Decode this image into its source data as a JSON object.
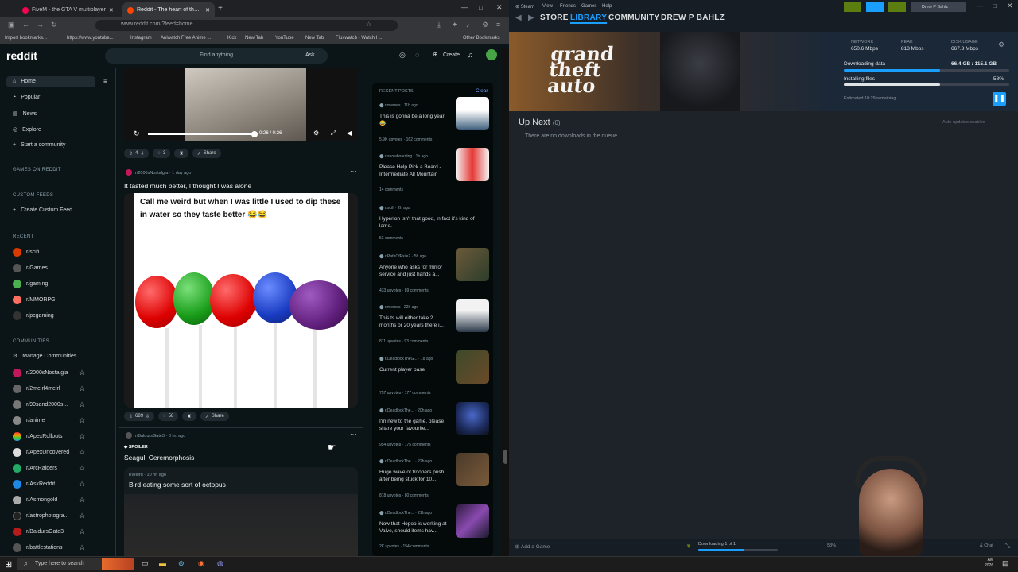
{
  "browser": {
    "tabs": [
      {
        "label": "FiveM - the GTA V multiplayer"
      },
      {
        "label": "Reddit - The heart of the intern"
      }
    ],
    "url": "www.reddit.com/?feed=home",
    "bookmarks": [
      "Import bookmarks...",
      "https://www.youtube...",
      "Instagram",
      "Aniwatch Free Anime ...",
      "Kick",
      "New Tab",
      "YouTube",
      "New Tab",
      "Fluxwatch - Watch H...",
      "Other Bookmarks"
    ]
  },
  "reddit": {
    "logo": "reddit",
    "search_placeholder": "Find anything",
    "ask": "Ask",
    "create": "Create",
    "nav": [
      "Home",
      "Popular",
      "News",
      "Explore",
      "Start a community"
    ],
    "games_header": "GAMES ON REDDIT",
    "custom_header": "CUSTOM FEEDS",
    "create_feed": "Create Custom Feed",
    "recent_header": "RECENT",
    "recent": [
      "r/scifi",
      "r/Games",
      "r/gaming",
      "r/MMORPG",
      "r/pcgaming"
    ],
    "communities_header": "COMMUNITIES",
    "manage": "Manage Communities",
    "communities": [
      "r/2000sNostalgia",
      "r/2meirl4meirl",
      "r/90sand2000s...",
      "r/anime",
      "r/ApexRollouts",
      "r/ApexUncovered",
      "r/ArcRaiders",
      "r/AskReddit",
      "r/Asmongold",
      "r/astrophotogra...",
      "r/BaldursGate3",
      "r/battlestations"
    ],
    "video": {
      "time": "0:26 / 0:26",
      "votes": "4",
      "comments": "3",
      "share": "Share"
    },
    "post1": {
      "sub": "r/2000sNostalgia",
      "age": "1 day ago",
      "title": "It tasted much better, I thought I was alone",
      "caption": "Call me weird but when I was little I used to dip these in water so they taste better 😂😂",
      "votes": "689",
      "comments": "58",
      "share": "Share"
    },
    "post2": {
      "sub": "r/BaldursGate3",
      "age": "3 hr. ago",
      "spoiler": "SPOILER",
      "title": "Seagull Ceremorphosis"
    },
    "post3": {
      "sub": "r/Weird",
      "age": "10 hr. ago",
      "title": "Bird eating some sort of octopus"
    },
    "recent_posts_header": "RECENT POSTS",
    "clear": "Clear",
    "recent_posts": [
      {
        "sub": "r/memes",
        "age": "11h ago",
        "title": "This is gonna be a long year 😂",
        "upvotes": "5.9K upvotes",
        "comments": "162 comments"
      },
      {
        "sub": "r/snowboarding",
        "age": "1h ago",
        "title": "Please Help Pick a Board - Intermediate All Mountain",
        "upvotes": "14 comments",
        "comments": ""
      },
      {
        "sub": "r/scifi",
        "age": "2h ago",
        "title": "Hyperion isn't that good, in fact it's kind of lame.",
        "upvotes": "53 comments",
        "comments": ""
      },
      {
        "sub": "r/PathOfExile2",
        "age": "5h ago",
        "title": "Anyone who asks for mirror service and just hands a...",
        "upvotes": "433 upvotes",
        "comments": "89 comments"
      },
      {
        "sub": "r/memes",
        "age": "22h ago",
        "title": "This ts will either take 2 months or 20 years there i...",
        "upvotes": "811 upvotes",
        "comments": "93 comments"
      },
      {
        "sub": "r/DeadlockTheG...",
        "age": "1d ago",
        "title": "Current player base",
        "upvotes": "757 upvotes",
        "comments": "177 comments"
      },
      {
        "sub": "r/DeadlockThe...",
        "age": "20h ago",
        "title": "I'm new to the game, please share your favourite...",
        "upvotes": "954 upvotes",
        "comments": "175 comments"
      },
      {
        "sub": "r/DeadlockThe...",
        "age": "22h ago",
        "title": "Huge wave of troopers push after being stuck for 10...",
        "upvotes": "818 upvotes",
        "comments": "80 comments"
      },
      {
        "sub": "r/DeadlockThe...",
        "age": "21h ago",
        "title": "Now that Hopoo is working at Valve, should items hav...",
        "upvotes": "2K upvotes",
        "comments": "154 comments"
      }
    ]
  },
  "steam": {
    "menu": [
      "Steam",
      "View",
      "Friends",
      "Games",
      "Help"
    ],
    "user": "Drew P Bahlz",
    "nav": [
      "STORE",
      "LIBRARY",
      "COMMUNITY",
      "DREW P BAHLZ"
    ],
    "game_logo": "grand theft auto",
    "network_label": "NETWORK",
    "network": "650.6 Mbps",
    "peak_label": "PEAK",
    "peak": "813 Mbps",
    "disk_label": "DISK USAGE",
    "disk": "667.3 Mbps",
    "downloading_label": "Downloading data",
    "downloading_value": "66.4 GB / 115.1 GB",
    "downloading_progress": 0.58,
    "installing_label": "Installing files",
    "installing_value": "58%",
    "installing_progress": 0.58,
    "remaining": "Estimated 10:29 remaining",
    "up_next": "Up Next",
    "up_next_count": "(0)",
    "auto_updates": "Auto-updates enabled",
    "empty": "There are no downloads in the queue",
    "add_game": "Add a Game",
    "bottom_status": "Downloading 1 of 1",
    "bottom_pct": "58%",
    "chat": "& Chat"
  },
  "taskbar": {
    "search": "Type here to search",
    "time": "AM",
    "date": "2026"
  },
  "colors": {
    "reddit_bg": "#0b1416",
    "reddit_orange": "#ff4500",
    "steam_blue": "#1a9fff",
    "steam_bg": "#1e2329"
  }
}
